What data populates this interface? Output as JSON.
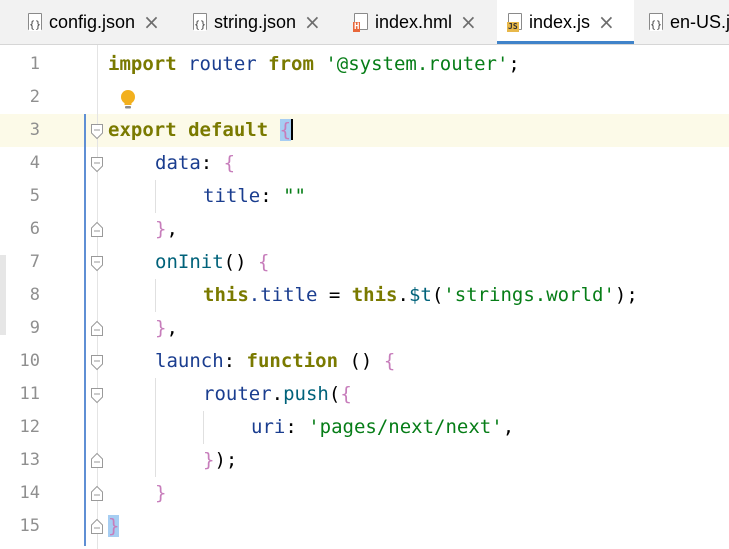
{
  "tabs": [
    {
      "label": "config.json",
      "icon": "json-file-icon",
      "active": false
    },
    {
      "label": "string.json",
      "icon": "json-file-icon",
      "active": false
    },
    {
      "label": "index.hml",
      "icon": "hml-file-icon",
      "active": false
    },
    {
      "label": "index.js",
      "icon": "js-file-icon",
      "active": true
    },
    {
      "label": "en-US.js",
      "icon": "json-file-icon",
      "active": false
    }
  ],
  "icons": {
    "close": "×",
    "json_badge": "{}",
    "hml_badge": "H",
    "js_badge": "JS"
  },
  "line_numbers": [
    "1",
    "2",
    "3",
    "4",
    "5",
    "6",
    "7",
    "8",
    "9",
    "10",
    "11",
    "12",
    "13",
    "14",
    "15"
  ],
  "code": {
    "l1": {
      "k1": "import",
      "t1": " router ",
      "k2": "from",
      "s1": " '@system.router'",
      "p1": ";"
    },
    "l3": {
      "k1": "export",
      "t1": " ",
      "k2": "default",
      "t2": " ",
      "b1": "{"
    },
    "l4": {
      "p1": "data",
      "t1": ": ",
      "b1": "{"
    },
    "l5": {
      "p1": "title",
      "t1": ": ",
      "s1": "\"\""
    },
    "l6": {
      "b1": "}",
      "t1": ","
    },
    "l7": {
      "f1": "onInit",
      "t1": "() ",
      "b1": "{"
    },
    "l8": {
      "k1": "this",
      "p1": ".title",
      "t1": " = ",
      "k2": "this",
      "t2": ".",
      "f1": "$t",
      "t3": "(",
      "s1": "'strings.world'",
      "t4": ");"
    },
    "l9": {
      "b1": "}",
      "t1": ","
    },
    "l10": {
      "p1": "launch",
      "t1": ": ",
      "k1": "function",
      "t2": " () ",
      "b1": "{"
    },
    "l11": {
      "p1": "router",
      "t1": ".",
      "f1": "push",
      "t2": "(",
      "b1": "{"
    },
    "l12": {
      "p1": "uri",
      "t1": ": ",
      "s1": "'pages/next/next'",
      "t2": ","
    },
    "l13": {
      "b1": "}",
      "t1": ");"
    },
    "l14": {
      "b1": "}"
    },
    "l15": {
      "b1": "}"
    }
  },
  "colors": {
    "accent": "#4083c9",
    "current_line": "#fcfae8",
    "bracket_match": "#a6cdf2"
  }
}
